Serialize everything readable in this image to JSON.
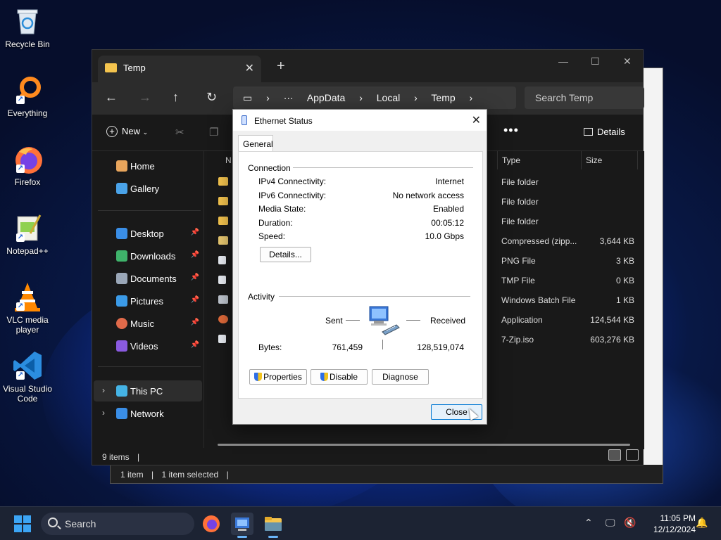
{
  "desktop": {
    "icons": [
      {
        "label": "Recycle Bin",
        "icon": "recycle-bin-icon"
      },
      {
        "label": "Everything",
        "icon": "everything-search-icon"
      },
      {
        "label": "Firefox",
        "icon": "firefox-icon"
      },
      {
        "label": "Notepad++",
        "icon": "notepad-plus-plus-icon"
      },
      {
        "label": "VLC media player",
        "icon": "vlc-icon"
      },
      {
        "label": "Visual Studio Code",
        "icon": "vscode-icon"
      }
    ]
  },
  "back_window": {
    "status_items": "1 item",
    "status_selected": "1 item selected"
  },
  "explorer": {
    "tab_title": "Temp",
    "new_tab": "+",
    "breadcrumb": [
      "AppData",
      "Local",
      "Temp"
    ],
    "search_placeholder": "Search Temp",
    "new_label": "New",
    "details_label": "Details",
    "columns": {
      "name": "N",
      "type": "Type",
      "size": "Size"
    },
    "sidebar": {
      "home": "Home",
      "gallery": "Gallery",
      "pinned": [
        "Desktop",
        "Downloads",
        "Documents",
        "Pictures",
        "Music",
        "Videos"
      ],
      "this_pc": "This PC",
      "network": "Network"
    },
    "files": [
      {
        "type": "File folder",
        "size": ""
      },
      {
        "type": "File folder",
        "size": ""
      },
      {
        "type": "File folder",
        "size": ""
      },
      {
        "type": "Compressed (zipp...",
        "size": "3,644 KB"
      },
      {
        "type": "PNG File",
        "size": "3 KB"
      },
      {
        "type": "TMP File",
        "size": "0 KB"
      },
      {
        "type": "Windows Batch File",
        "size": "1 KB"
      },
      {
        "type": "Application",
        "size": "124,544 KB"
      },
      {
        "type": "7-Zip.iso",
        "size": "603,276 KB"
      }
    ],
    "status": "9 items"
  },
  "dialog": {
    "title": "Ethernet Status",
    "tab": "General",
    "connection_heading": "Connection",
    "connection": [
      {
        "label": "IPv4 Connectivity:",
        "value": "Internet"
      },
      {
        "label": "IPv6 Connectivity:",
        "value": "No network access"
      },
      {
        "label": "Media State:",
        "value": "Enabled"
      },
      {
        "label": "Duration:",
        "value": "00:05:12"
      },
      {
        "label": "Speed:",
        "value": "10.0 Gbps"
      }
    ],
    "details_button": "Details...",
    "activity_heading": "Activity",
    "sent_label": "Sent",
    "received_label": "Received",
    "bytes_label": "Bytes:",
    "bytes_sent": "761,459",
    "bytes_received": "128,519,074",
    "properties_button": "Properties",
    "disable_button": "Disable",
    "diagnose_button": "Diagnose",
    "close_button": "Close"
  },
  "taskbar": {
    "search_label": "Search",
    "time": "11:05 PM",
    "date": "12/12/2024"
  },
  "colors": {
    "accent": "#0078d4",
    "folder": "#f4c44e",
    "taskbar": "#1c2333"
  }
}
